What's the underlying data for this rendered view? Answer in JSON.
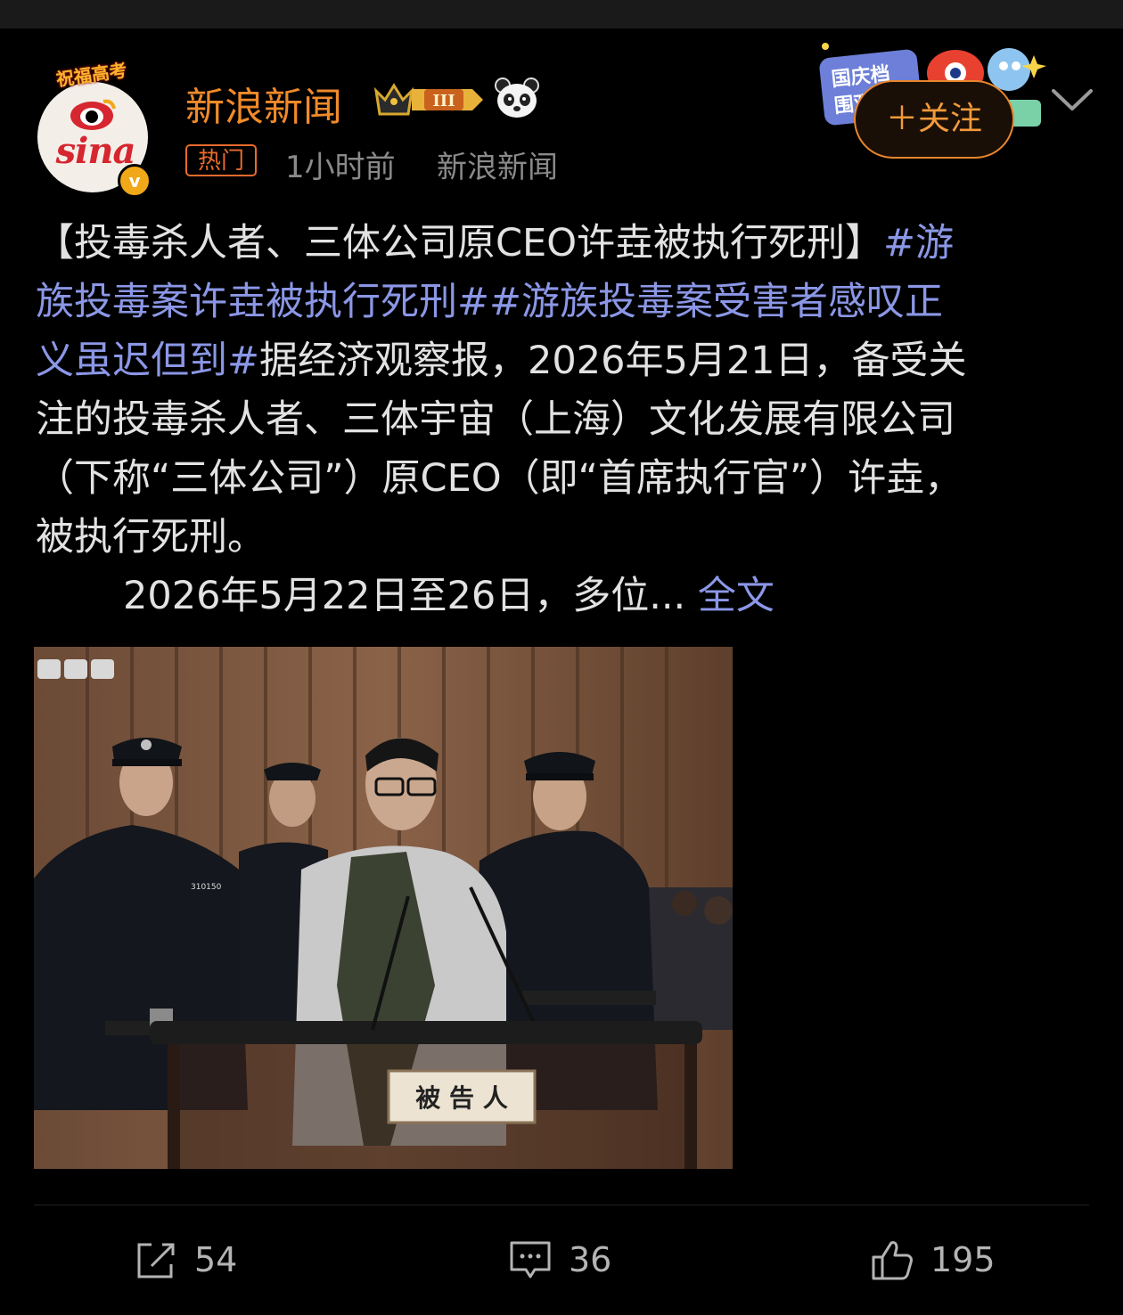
{
  "account": {
    "name": "新浪新闻",
    "avatar_text": "sina",
    "avatar_banner": "祝福高考",
    "level_badge": "III",
    "verified_icon": "verified-icon"
  },
  "meta": {
    "badge": "热门",
    "time": "1小时前",
    "source": "新浪新闻"
  },
  "follow_button": "＋关注",
  "sticker_text": "国庆档 围观",
  "post": {
    "line1_text": "【投毒杀人者、三体公司原CEO许垚被执行死刑】",
    "line1_tag": "#游",
    "line2_tag": "族投毒案许垚被执行死刑##游族投毒案受害者感叹正",
    "line3_tag": "义虽迟但到#",
    "line3_text": "据经济观察报，2026年5月21日，备受关",
    "line4": "注的投毒杀人者、三体宇宙（上海）文化发展有限公司",
    "line5": "（下称“三体公司”）原CEO（即“首席执行官”）许垚，",
    "line6": "被执行死刑。",
    "line7": "2026年5月22日至26日，多位...",
    "full_text_link": "全文"
  },
  "photo": {
    "sign_text": "被 告 人",
    "badge_number": "310150"
  },
  "actions": {
    "share_count": "54",
    "comment_count": "36",
    "like_count": "195"
  },
  "colors": {
    "accent_orange": "#f08a2a",
    "hashtag_blue": "#8b97e6",
    "background": "#000000"
  }
}
